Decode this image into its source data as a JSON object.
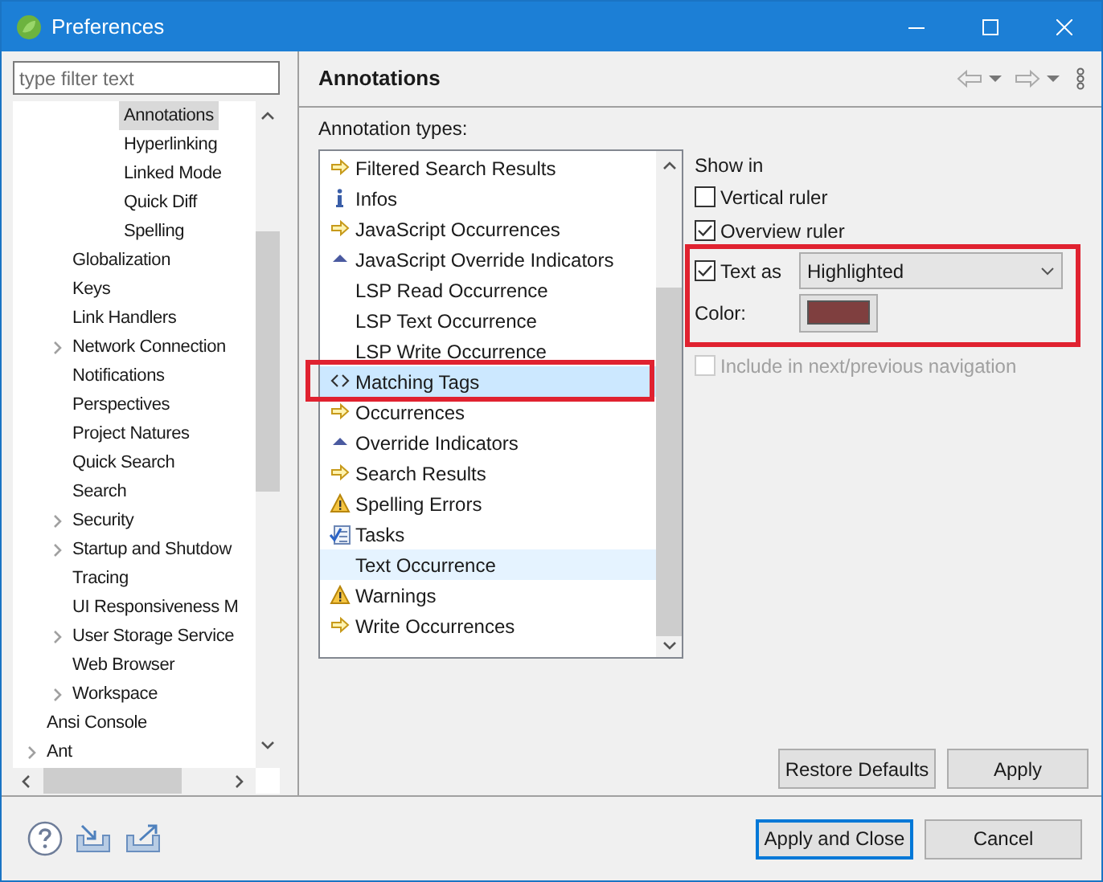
{
  "window": {
    "title": "Preferences"
  },
  "filter": {
    "placeholder": "type filter text"
  },
  "tree": [
    {
      "children": [
        {
          "children": [
            {
              "label": "Annotations",
              "selected": true,
              "expandable": false
            },
            {
              "label": "Hyperlinking",
              "selected": false,
              "expandable": false
            },
            {
              "label": "Linked Mode",
              "selected": false,
              "expandable": false
            },
            {
              "label": "Quick Diff",
              "selected": false,
              "expandable": false
            },
            {
              "label": "Spelling",
              "selected": false,
              "expandable": false
            }
          ]
        },
        {
          "label": "Globalization",
          "selected": false,
          "expandable": false
        },
        {
          "label": "Keys",
          "selected": false,
          "expandable": false
        },
        {
          "label": "Link Handlers",
          "selected": false,
          "expandable": false
        },
        {
          "label": "Network Connection",
          "selected": false,
          "expandable": true
        },
        {
          "label": "Notifications",
          "selected": false,
          "expandable": false
        },
        {
          "label": "Perspectives",
          "selected": false,
          "expandable": false
        },
        {
          "label": "Project Natures",
          "selected": false,
          "expandable": false
        },
        {
          "label": "Quick Search",
          "selected": false,
          "expandable": false
        },
        {
          "label": "Search",
          "selected": false,
          "expandable": false
        },
        {
          "label": "Security",
          "selected": false,
          "expandable": true
        },
        {
          "label": "Startup and Shutdow",
          "selected": false,
          "expandable": true
        },
        {
          "label": "Tracing",
          "selected": false,
          "expandable": false
        },
        {
          "label": "UI Responsiveness M",
          "selected": false,
          "expandable": false
        },
        {
          "label": "User Storage Service",
          "selected": false,
          "expandable": true
        },
        {
          "label": "Web Browser",
          "selected": false,
          "expandable": false
        },
        {
          "label": "Workspace",
          "selected": false,
          "expandable": true
        }
      ]
    },
    {
      "label": "Ansi Console",
      "selected": false,
      "expandable": false
    },
    {
      "label": "Ant",
      "selected": false,
      "expandable": true
    }
  ],
  "page": {
    "title": "Annotations",
    "types_label": "Annotation types:"
  },
  "annotation_types": [
    {
      "label": "Filtered Search Results",
      "kind": "arrow",
      "selected": false,
      "hot": false,
      "framed": false
    },
    {
      "label": "Infos",
      "kind": "info",
      "selected": false,
      "hot": false,
      "framed": false
    },
    {
      "label": "JavaScript Occurrences",
      "kind": "arrow",
      "selected": false,
      "hot": false,
      "framed": false
    },
    {
      "label": "JavaScript Override Indicators",
      "kind": "triangle",
      "selected": false,
      "hot": false,
      "framed": false
    },
    {
      "label": "LSP Read Occurrence",
      "kind": "none",
      "selected": false,
      "hot": false,
      "framed": false
    },
    {
      "label": "LSP Text Occurrence",
      "kind": "none",
      "selected": false,
      "hot": false,
      "framed": false
    },
    {
      "label": "LSP Write Occurrence",
      "kind": "none",
      "selected": false,
      "hot": false,
      "framed": false
    },
    {
      "label": "Matching Tags",
      "kind": "tags",
      "selected": true,
      "hot": false,
      "framed": true
    },
    {
      "label": "Occurrences",
      "kind": "arrow",
      "selected": false,
      "hot": false,
      "framed": false
    },
    {
      "label": "Override Indicators",
      "kind": "triangle",
      "selected": false,
      "hot": false,
      "framed": false
    },
    {
      "label": "Search Results",
      "kind": "arrow",
      "selected": false,
      "hot": false,
      "framed": false
    },
    {
      "label": "Spelling Errors",
      "kind": "warning",
      "selected": false,
      "hot": false,
      "framed": false
    },
    {
      "label": "Tasks",
      "kind": "tasks",
      "selected": false,
      "hot": false,
      "framed": false
    },
    {
      "label": "Text Occurrence",
      "kind": "none",
      "selected": false,
      "hot": true,
      "framed": false
    },
    {
      "label": "Warnings",
      "kind": "warning",
      "selected": false,
      "hot": false,
      "framed": false
    },
    {
      "label": "Write Occurrences",
      "kind": "arrow",
      "selected": false,
      "hot": false,
      "framed": false
    }
  ],
  "options": {
    "show_in": "Show in",
    "vertical_ruler": {
      "label": "Vertical ruler",
      "checked": false
    },
    "overview_ruler": {
      "label": "Overview ruler",
      "checked": true
    },
    "text_as": {
      "label": "Text as",
      "checked": true,
      "value": "Highlighted",
      "framed": true
    },
    "color": {
      "label": "Color:",
      "color": "#7f3f3f"
    },
    "navigation": {
      "label": "Include in next/previous navigation",
      "checked": false,
      "disabled": true
    }
  },
  "page_buttons": [
    "Restore Defaults",
    "Apply"
  ],
  "dialog_buttons": [
    {
      "label": "Apply and Close",
      "default": true
    },
    {
      "label": "Cancel",
      "default": false
    }
  ]
}
